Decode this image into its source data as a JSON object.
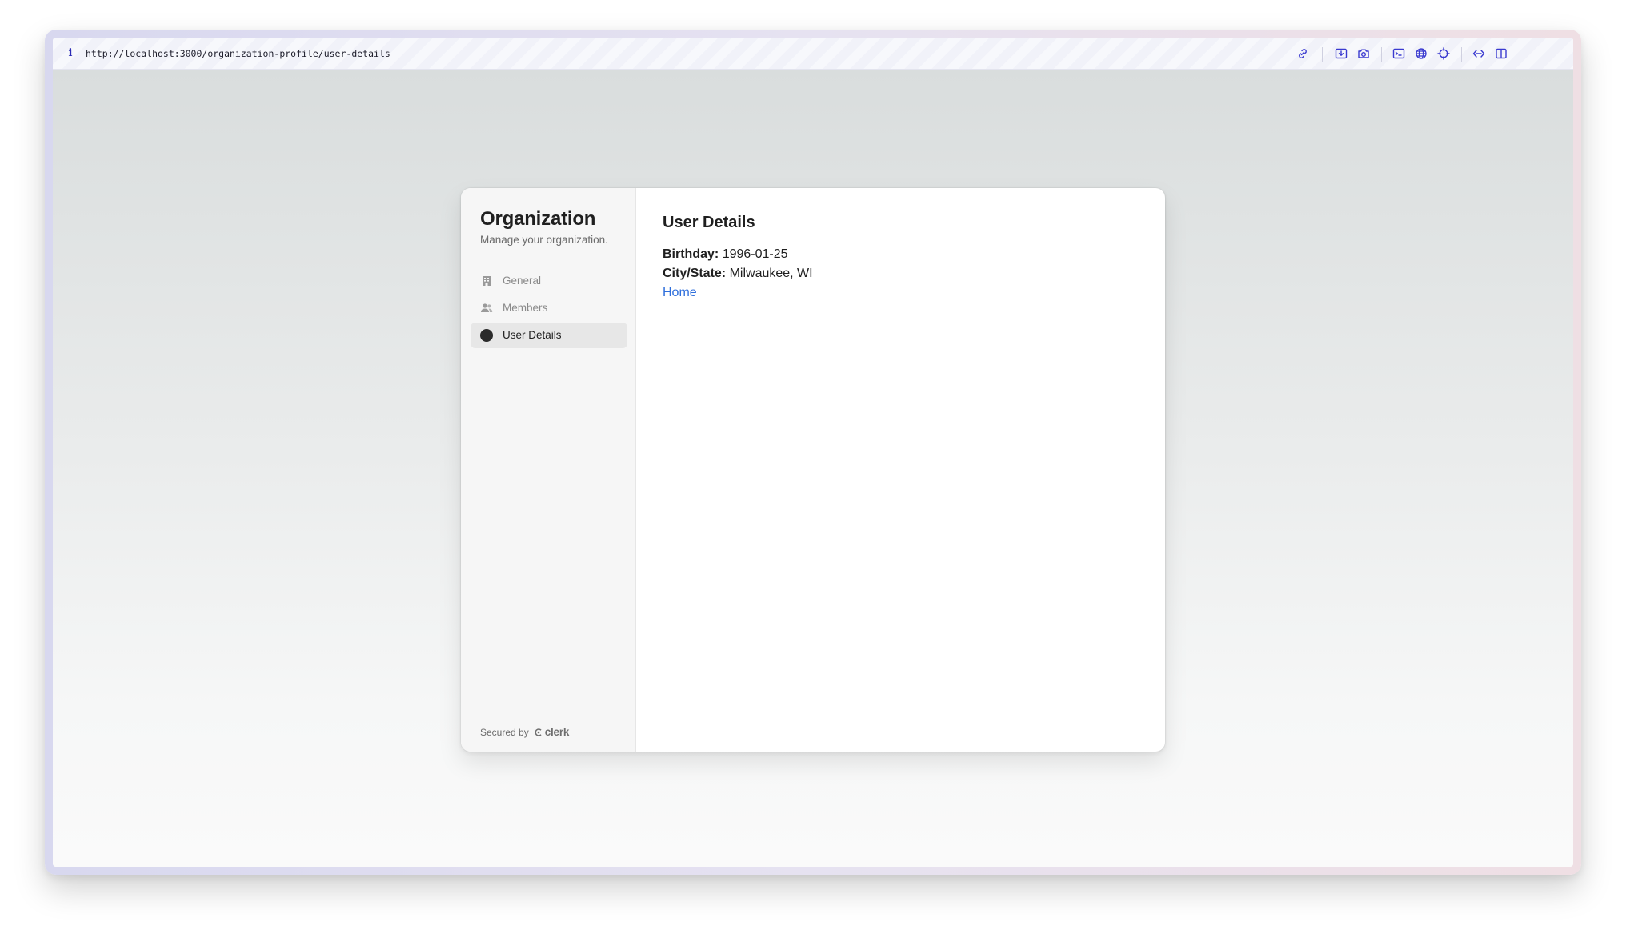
{
  "browser": {
    "url": "http://localhost:3000/organization-profile/user-details",
    "toolbar_icons": [
      "link-icon",
      "download-icon",
      "camera-icon",
      "terminal-icon",
      "globe-icon",
      "crosshair-icon",
      "code-icon",
      "split-view-icon"
    ],
    "accent_color": "#3a3ad0"
  },
  "sidebar": {
    "title": "Organization",
    "subtitle": "Manage your organization.",
    "items": [
      {
        "label": "General",
        "icon": "building-icon",
        "active": false
      },
      {
        "label": "Members",
        "icon": "users-icon",
        "active": false
      },
      {
        "label": "User Details",
        "icon": "dot-icon",
        "active": true
      }
    ],
    "footer": {
      "secured_by": "Secured by",
      "brand": "clerk"
    }
  },
  "main": {
    "title": "User Details",
    "birthday_label": "Birthday:",
    "birthday_value": "1996-01-25",
    "city_label": "City/State:",
    "city_value": "Milwaukee, WI",
    "home_link": "Home"
  }
}
